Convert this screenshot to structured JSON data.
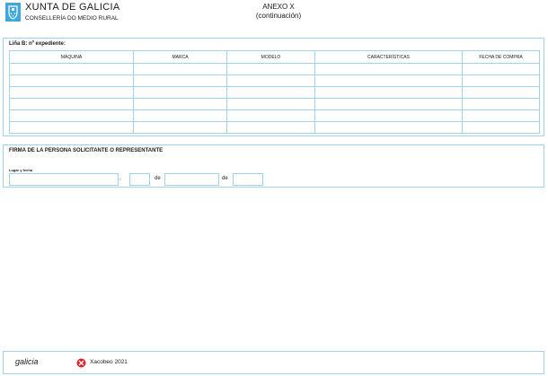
{
  "header": {
    "org_name": "XUNTA DE GALICIA",
    "department": "CONSELLERÍA DO MEDIO RURAL",
    "annex_title": "ANEXO X",
    "annex_subtitle": "(continuación)",
    "logo_color": "#3ea8dc"
  },
  "machines_section": {
    "title": "Liña B: nº expediente:",
    "columns": [
      "MÁQUINA",
      "MARCA",
      "MODELO",
      "CARACTERÍSTICAS",
      "FECHA DE COMPRA"
    ],
    "rows": [
      [
        "",
        "",
        "",
        "",
        ""
      ],
      [
        "",
        "",
        "",
        "",
        ""
      ],
      [
        "",
        "",
        "",
        "",
        ""
      ],
      [
        "",
        "",
        "",
        "",
        ""
      ],
      [
        "",
        "",
        "",
        "",
        ""
      ],
      [
        "",
        "",
        "",
        "",
        ""
      ]
    ]
  },
  "signature_section": {
    "title": "FIRMA DE LA PERSONA SOLICITANTE O REPRESENTANTE",
    "place_date_label": "Lugar y fecha",
    "comma": ",",
    "de_1": "de",
    "de_2": "de",
    "values": {
      "place": "",
      "day": "",
      "month": "",
      "year": ""
    }
  },
  "footer": {
    "brand": "galicia",
    "event": "Xacobeo 2021",
    "event_icon_color": "#d9232e"
  },
  "border_color": "#9fd3ec"
}
